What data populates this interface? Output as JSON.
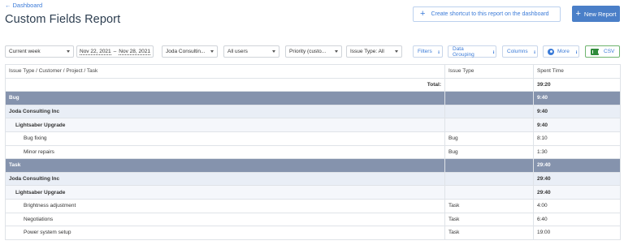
{
  "breadcrumb": {
    "back_label": "Dashboard"
  },
  "page": {
    "title": "Custom Fields Report"
  },
  "header_actions": {
    "shortcut_label": "Create shortcut to this report on the dashboard",
    "new_report_label": "New Report"
  },
  "filters": {
    "period": "Current week",
    "date_from": "Nov 22, 2021",
    "date_separator": "–",
    "date_to": "Nov 28, 2021",
    "customer": "Joda Consultin...",
    "users": "All users",
    "priority": "Priority (custo...",
    "issue_type": "Issue Type: All"
  },
  "toolbar": {
    "filters_label": "Filters",
    "grouping_label": "Data Grouping",
    "columns_label": "Columns",
    "more_label": "More",
    "csv_label": "CSV"
  },
  "table": {
    "headers": [
      "Issue Type / Customer / Project / Task",
      "Issue Type",
      "Spent Time"
    ],
    "total_label": "Total:",
    "total_value": "39:20",
    "rows": [
      {
        "level": 1,
        "name": "Bug",
        "type": "",
        "time": "9:40"
      },
      {
        "level": 2,
        "name": "Joda Consulting Inc",
        "type": "",
        "time": "9:40"
      },
      {
        "level": 3,
        "name": "Lightsaber Upgrade",
        "type": "",
        "time": "9:40"
      },
      {
        "level": 4,
        "name": "Bug fixing",
        "type": "Bug",
        "time": "8:10"
      },
      {
        "level": 4,
        "name": "Minor repairs",
        "type": "Bug",
        "time": "1:30"
      },
      {
        "level": 1,
        "name": "Task",
        "type": "",
        "time": "29:40"
      },
      {
        "level": 2,
        "name": "Joda Consulting Inc",
        "type": "",
        "time": "29:40"
      },
      {
        "level": 3,
        "name": "Lightsaber Upgrade",
        "type": "",
        "time": "29:40"
      },
      {
        "level": 4,
        "name": "Brightness adjustment",
        "type": "Task",
        "time": "4:00"
      },
      {
        "level": 4,
        "name": "Negotiations",
        "type": "Task",
        "time": "6:40"
      },
      {
        "level": 4,
        "name": "Power system setup",
        "type": "Task",
        "time": "19:00"
      }
    ]
  },
  "colors": {
    "accent": "#3b7bd8",
    "primary_button": "#4a7fc8",
    "group_level1": "#8593ad",
    "group_level2": "#e9eef6",
    "csv_icon": "#2e8b3a"
  }
}
